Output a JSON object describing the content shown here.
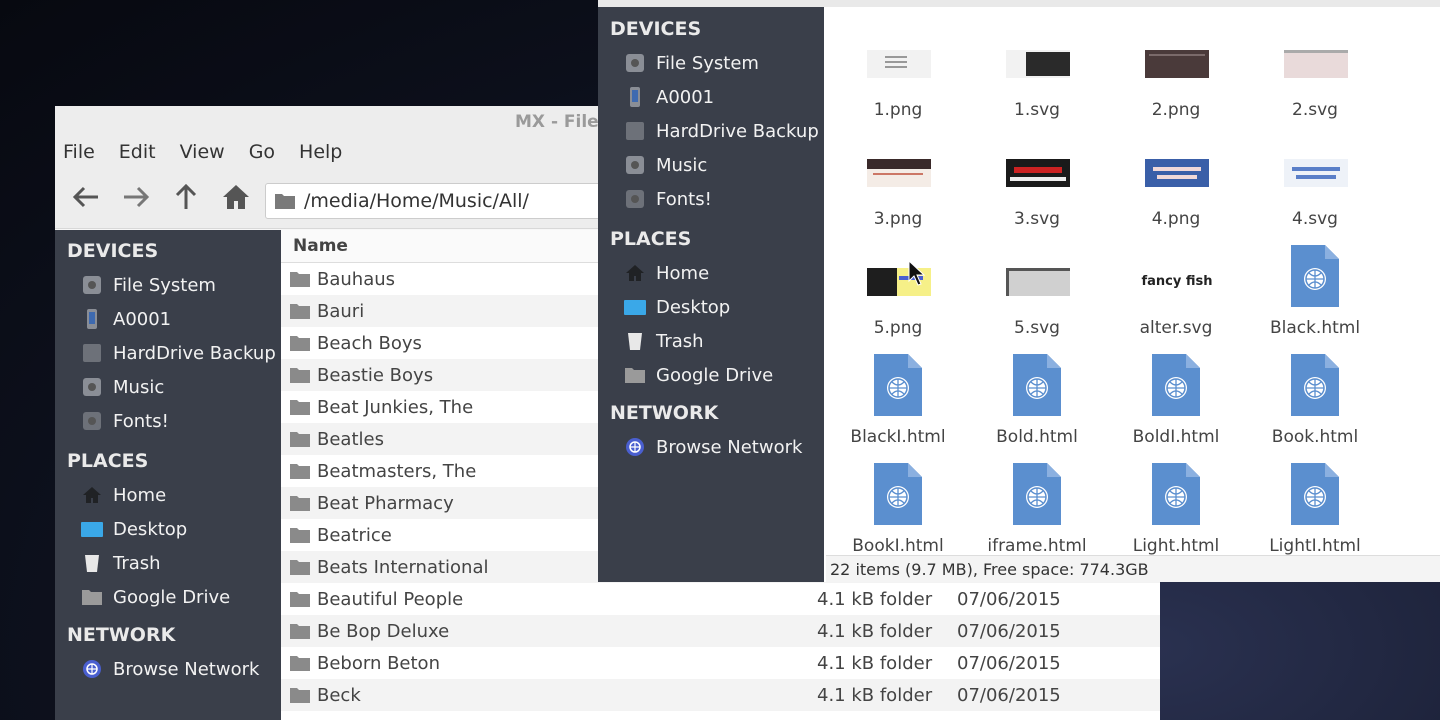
{
  "back_window": {
    "title": "MX - File M",
    "menu": [
      "File",
      "Edit",
      "View",
      "Go",
      "Help"
    ],
    "path": "/media/Home/Music/All/",
    "column_name": "Name",
    "rows": [
      {
        "name": "Bauhaus",
        "size": "",
        "date": ""
      },
      {
        "name": "Bauri",
        "size": "",
        "date": ""
      },
      {
        "name": "Beach Boys",
        "size": "",
        "date": ""
      },
      {
        "name": "Beastie Boys",
        "size": "",
        "date": ""
      },
      {
        "name": "Beat Junkies, The",
        "size": "",
        "date": ""
      },
      {
        "name": "Beatles",
        "size": "",
        "date": ""
      },
      {
        "name": "Beatmasters, The",
        "size": "",
        "date": ""
      },
      {
        "name": "Beat Pharmacy",
        "size": "",
        "date": ""
      },
      {
        "name": "Beatrice",
        "size": "",
        "date": ""
      },
      {
        "name": "Beats International",
        "size": "",
        "date": ""
      },
      {
        "name": "Beautiful People",
        "size": "4.1 kB folder",
        "date": "07/06/2015"
      },
      {
        "name": "Be Bop Deluxe",
        "size": "4.1 kB folder",
        "date": "07/06/2015"
      },
      {
        "name": "Beborn Beton",
        "size": "4.1 kB folder",
        "date": "07/06/2015"
      },
      {
        "name": "Beck",
        "size": "4.1 kB folder",
        "date": "07/06/2015"
      }
    ]
  },
  "sidebar": {
    "devices_header": "DEVICES",
    "devices": [
      {
        "label": "File System",
        "icon": "disk-icon"
      },
      {
        "label": "A0001",
        "icon": "phone-icon"
      },
      {
        "label": "HardDrive Backup",
        "icon": "drive-icon"
      },
      {
        "label": "Music",
        "icon": "disk-icon"
      },
      {
        "label": "Fonts!",
        "icon": "disk-icon"
      }
    ],
    "places_header": "PLACES",
    "places": [
      {
        "label": "Home",
        "icon": "home-icon"
      },
      {
        "label": "Desktop",
        "icon": "desktop-icon"
      },
      {
        "label": "Trash",
        "icon": "trash-icon"
      },
      {
        "label": "Google Drive",
        "icon": "folder-icon"
      }
    ],
    "network_header": "NETWORK",
    "network": [
      {
        "label": "Browse Network",
        "icon": "network-icon"
      }
    ]
  },
  "front_window": {
    "files": [
      {
        "name": "1.png",
        "kind": "image"
      },
      {
        "name": "1.svg",
        "kind": "image"
      },
      {
        "name": "2.png",
        "kind": "image"
      },
      {
        "name": "2.svg",
        "kind": "image"
      },
      {
        "name": "3.png",
        "kind": "image"
      },
      {
        "name": "3.svg",
        "kind": "image"
      },
      {
        "name": "4.png",
        "kind": "image"
      },
      {
        "name": "4.svg",
        "kind": "image"
      },
      {
        "name": "5.png",
        "kind": "image"
      },
      {
        "name": "5.svg",
        "kind": "image"
      },
      {
        "name": "alter.svg",
        "kind": "image",
        "thumb_text": "fancy fish"
      },
      {
        "name": "Black.html",
        "kind": "html"
      },
      {
        "name": "BlackI.html",
        "kind": "html"
      },
      {
        "name": "Bold.html",
        "kind": "html"
      },
      {
        "name": "BoldI.html",
        "kind": "html"
      },
      {
        "name": "Book.html",
        "kind": "html"
      },
      {
        "name": "BookI.html",
        "kind": "html"
      },
      {
        "name": "iframe.html",
        "kind": "html"
      },
      {
        "name": "Light.html",
        "kind": "html"
      },
      {
        "name": "LightI.html",
        "kind": "html"
      }
    ],
    "status": "22 items (9.7 MB), Free space:  774.3GB"
  },
  "colors": {
    "sidebar_bg": "#3a3f4a",
    "html_doc": "#5b8fcf",
    "desktop_icon": "#3aa8e8",
    "network_icon": "#4a5fd0"
  }
}
